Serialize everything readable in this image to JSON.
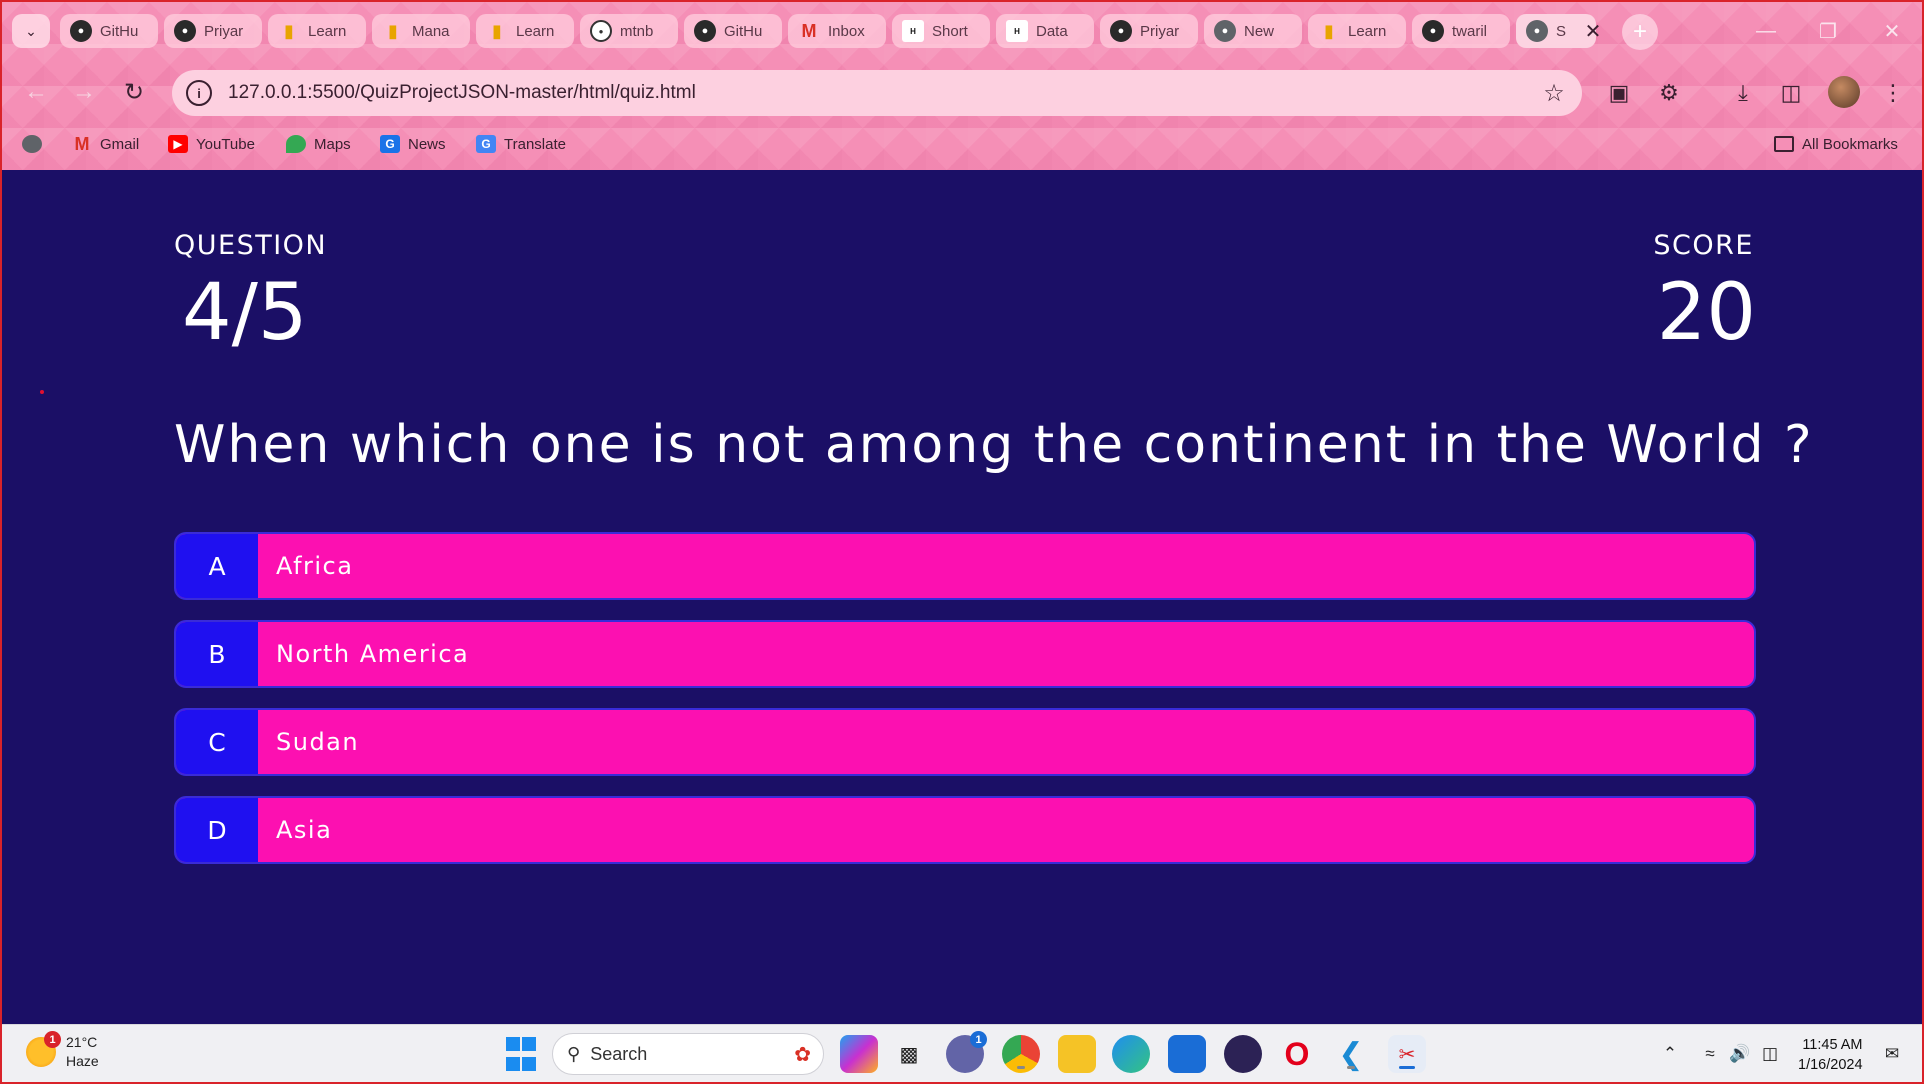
{
  "browser": {
    "tabs": [
      {
        "label": "GitHu",
        "icon": "github-icon"
      },
      {
        "label": "Priyar",
        "icon": "github-icon"
      },
      {
        "label": "Learn",
        "icon": "bar-chart-icon"
      },
      {
        "label": "Mana",
        "icon": "bar-chart-icon"
      },
      {
        "label": "Learn",
        "icon": "bar-chart-icon"
      },
      {
        "label": "mtnb",
        "icon": "mtn-icon"
      },
      {
        "label": "GitHu",
        "icon": "github-icon"
      },
      {
        "label": "Inbox",
        "icon": "gmail-icon"
      },
      {
        "label": "Short",
        "icon": "hot-icon"
      },
      {
        "label": "Data",
        "icon": "hot-icon"
      },
      {
        "label": "Priyar",
        "icon": "github-icon"
      },
      {
        "label": "New",
        "icon": "chrome-icon"
      },
      {
        "label": "Learn",
        "icon": "bar-chart-icon"
      },
      {
        "label": "twaril",
        "icon": "github-icon"
      }
    ],
    "active_tab": {
      "label": "S",
      "icon": "globe-icon"
    },
    "url": "127.0.0.1:5500/QuizProjectJSON-master/html/quiz.html",
    "bookmarks": [
      {
        "label": "Gmail"
      },
      {
        "label": "YouTube"
      },
      {
        "label": "Maps"
      },
      {
        "label": "News"
      },
      {
        "label": "Translate"
      }
    ],
    "all_bookmarks": "All Bookmarks",
    "theme_color": "#f58fb6"
  },
  "quiz": {
    "question_label": "QUESTION",
    "question_counter": "4/5",
    "score_label": "SCORE",
    "score_value": "20",
    "question_text": "When which one is not among the continent in the World ?",
    "choices": [
      {
        "prefix": "A",
        "text": "Africa"
      },
      {
        "prefix": "B",
        "text": "North America"
      },
      {
        "prefix": "C",
        "text": "Sudan"
      },
      {
        "prefix": "D",
        "text": "Asia"
      }
    ],
    "colors": {
      "background": "#1b0f66",
      "choice": "#fc10b1",
      "prefix": "#1f10f0"
    }
  },
  "taskbar": {
    "weather_temp": "21°C",
    "weather_desc": "Haze",
    "weather_badge": "1",
    "search_placeholder": "Search",
    "chat_badge": "1",
    "time": "11:45 AM",
    "date": "1/16/2024"
  }
}
